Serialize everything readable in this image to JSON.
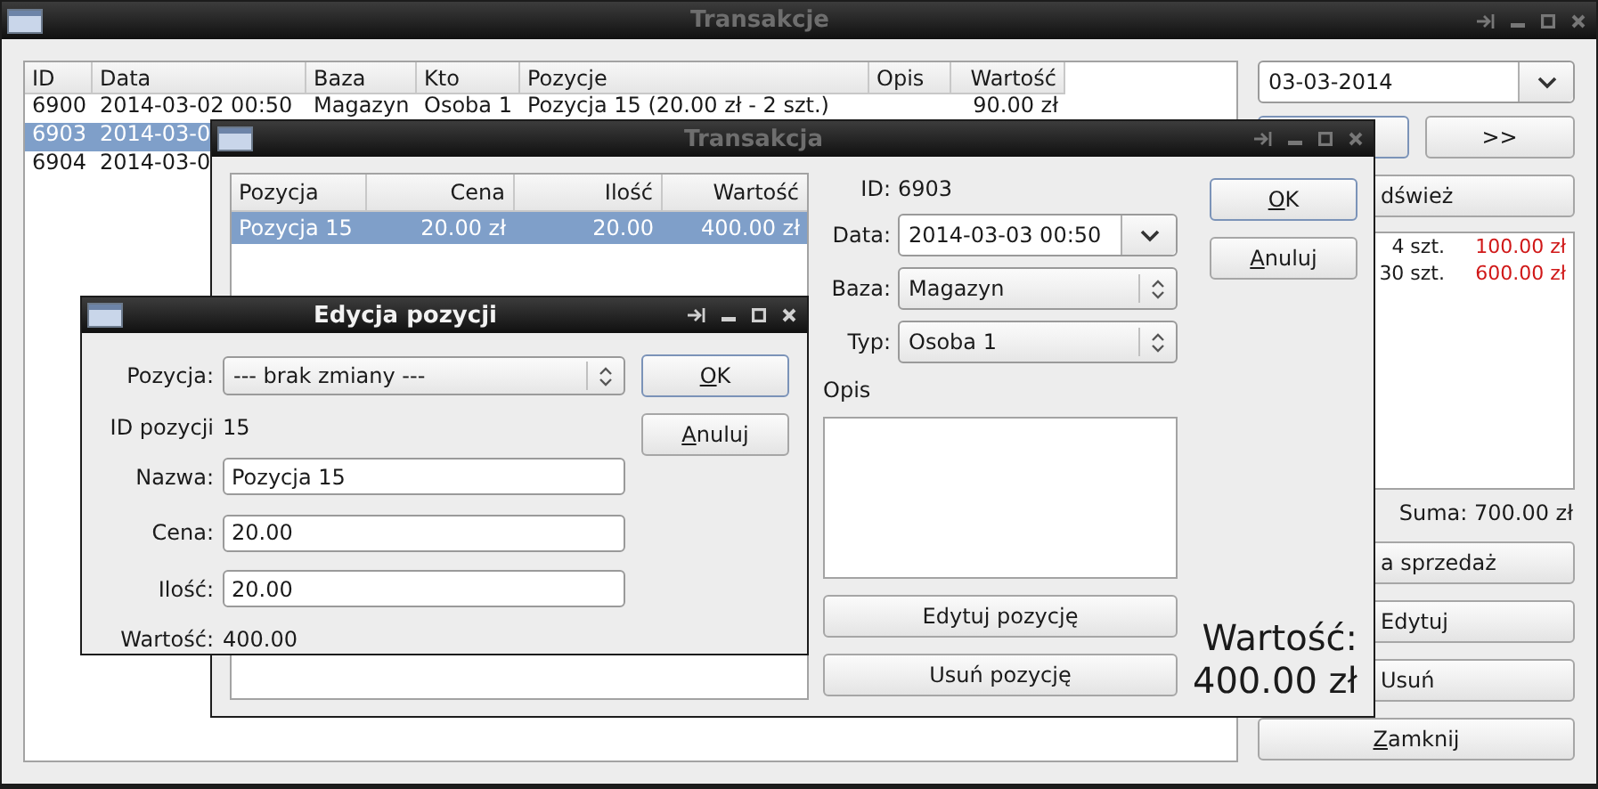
{
  "main_window": {
    "title": "Transakcje",
    "active": false,
    "table": {
      "columns": [
        "ID",
        "Data",
        "Baza",
        "Kto",
        "Pozycje",
        "Opis",
        "Wartość"
      ],
      "rows": [
        {
          "id": "6900",
          "date": "2014-03-02 00:50",
          "base": "Magazyn",
          "who": "Osoba 1",
          "items": "Pozycja 15 (20.00 zł - 2 szt.)",
          "value": "90.00 zł",
          "selected": false
        },
        {
          "id": "6903",
          "date": "2014-03-0",
          "selected": true
        },
        {
          "id": "6904",
          "date": "2014-03-0",
          "selected": false
        }
      ]
    },
    "date_combo": {
      "value": "03-03-2014"
    },
    "nav_buttons": [
      {
        "kind": "covered"
      },
      {
        "kind": "text",
        "label": ">>"
      }
    ],
    "refresh_button": {
      "label": "dśwież",
      "covered": true
    },
    "summary_rows": [
      {
        "qty": "4 szt.",
        "amount": "100.00 zł"
      },
      {
        "qty": "30 szt.",
        "amount": "600.00 zł"
      }
    ],
    "total": "Suma: 700.00 zł",
    "action_buttons": [
      {
        "label": "a sprzedaż",
        "covered": true
      },
      {
        "label": "Edytuj",
        "covered": true
      },
      {
        "label": "Usuń",
        "covered": true
      },
      {
        "label": "Zamknij",
        "covered": false,
        "mnemonic": true
      }
    ]
  },
  "transaction_window": {
    "title": "Transakcja",
    "active": false,
    "items_table": {
      "columns": [
        "Pozycja",
        "Cena",
        "Ilość",
        "Wartość"
      ],
      "rows": [
        {
          "name": "Pozycja 15",
          "price": "20.00 zł",
          "qty": "20.00",
          "value": "400.00 zł",
          "selected": true
        }
      ]
    },
    "id_label": "ID:",
    "id_value": "6903",
    "fields": [
      {
        "label": "Data:",
        "value": "2014-03-03 00:50",
        "kind": "editable"
      },
      {
        "label": "Baza:",
        "value": "Magazyn",
        "kind": "select"
      },
      {
        "label": "Typ:",
        "value": "Osoba 1",
        "kind": "select"
      }
    ],
    "description_label": "Opis",
    "item_buttons": [
      "Edytuj pozycję",
      "Usuń pozycję"
    ],
    "dialog_buttons": [
      {
        "label": "OK",
        "default": true,
        "mnemonic": true
      },
      {
        "label": "Anuluj",
        "default": false,
        "mnemonic": true
      }
    ],
    "total_label": "Wartość:",
    "total_value": "400.00 zł"
  },
  "edit_window": {
    "title": "Edycja pozycji",
    "active": true,
    "rows": [
      {
        "kind": "select",
        "label": "Pozycja:",
        "value": "--- brak zmiany ---"
      },
      {
        "kind": "text",
        "label": "ID pozycji",
        "value": "15"
      },
      {
        "kind": "input",
        "label": "Nazwa:",
        "value": "Pozycja 15"
      },
      {
        "kind": "input",
        "label": "Cena:",
        "value": "20.00"
      },
      {
        "kind": "input",
        "label": "Ilość:",
        "value": "20.00"
      },
      {
        "kind": "text",
        "label": "Wartość:",
        "value": "400.00"
      }
    ],
    "buttons": [
      {
        "label": "OK",
        "default": true,
        "mnemonic": true
      },
      {
        "label": "Anuluj",
        "default": false,
        "mnemonic": true
      }
    ]
  }
}
